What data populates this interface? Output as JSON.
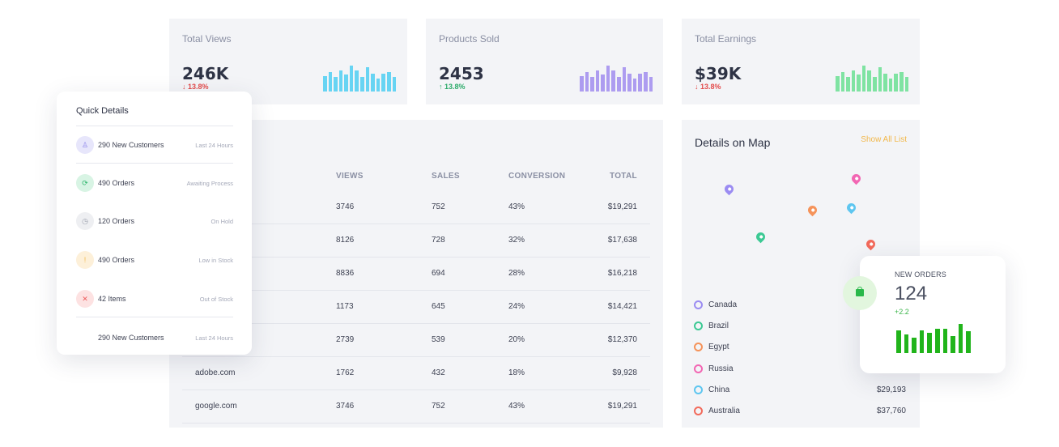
{
  "stats": [
    {
      "title": "Total Views",
      "value": "246K",
      "delta": "13.8%",
      "direction": "down",
      "color": "#67d4f3",
      "bars": [
        0.6,
        0.75,
        0.55,
        0.8,
        0.65,
        1.0,
        0.8,
        0.55,
        0.95,
        0.7,
        0.5,
        0.7,
        0.75,
        0.55
      ]
    },
    {
      "title": "Products Sold",
      "value": "2453",
      "delta": "13.8%",
      "direction": "up",
      "color": "#ad9cf0",
      "bars": [
        0.6,
        0.75,
        0.55,
        0.8,
        0.65,
        1.0,
        0.8,
        0.55,
        0.95,
        0.7,
        0.5,
        0.7,
        0.75,
        0.55
      ]
    },
    {
      "title": "Total Earnings",
      "value": "$39K",
      "delta": "13.8%",
      "direction": "down",
      "color": "#7fe3a2",
      "bars": [
        0.6,
        0.75,
        0.55,
        0.8,
        0.65,
        1.0,
        0.8,
        0.55,
        0.95,
        0.7,
        0.5,
        0.7,
        0.75,
        0.55
      ]
    }
  ],
  "table": {
    "headers": [
      "VIEWS",
      "SALES",
      "CONVERSION",
      "TOTAL"
    ],
    "rows": [
      {
        "source": "",
        "views": "3746",
        "sales": "752",
        "conversion": "43%",
        "total": "$19,291"
      },
      {
        "source": "",
        "views": "8126",
        "sales": "728",
        "conversion": "32%",
        "total": "$17,638"
      },
      {
        "source": "",
        "views": "8836",
        "sales": "694",
        "conversion": "28%",
        "total": "$16,218"
      },
      {
        "source": "",
        "views": "1173",
        "sales": "645",
        "conversion": "24%",
        "total": "$14,421"
      },
      {
        "source": "",
        "views": "2739",
        "sales": "539",
        "conversion": "20%",
        "total": "$12,370"
      },
      {
        "source": "adobe.com",
        "views": "1762",
        "sales": "432",
        "conversion": "18%",
        "total": "$9,928"
      },
      {
        "source": "google.com",
        "views": "3746",
        "sales": "752",
        "conversion": "43%",
        "total": "$19,291"
      }
    ]
  },
  "map": {
    "title": "Details on Map",
    "show_all": "Show All List",
    "countries": [
      {
        "name": "Canada",
        "value": "",
        "color": "#9b8cf2"
      },
      {
        "name": "Brazil",
        "value": "",
        "color": "#3cc994"
      },
      {
        "name": "Egypt",
        "value": "",
        "color": "#f5935a"
      },
      {
        "name": "Russia",
        "value": "",
        "color": "#f266b3"
      },
      {
        "name": "China",
        "value": "$29,193",
        "color": "#5ec6f0"
      },
      {
        "name": "Australia",
        "value": "$37,760",
        "color": "#f26a5b"
      }
    ]
  },
  "quick_details": {
    "title": "Quick Details",
    "items": [
      {
        "label": "290 New Customers",
        "meta": "Last 24 Hours",
        "icon": "user-plus-icon",
        "glyph": "♙",
        "bg": "#e7e6fb",
        "fg": "#8b82ea"
      },
      {
        "label": "490 Orders",
        "meta": "Awaiting Process",
        "icon": "refresh-icon",
        "glyph": "⟳",
        "bg": "#d8f4e4",
        "fg": "#2cb56b"
      },
      {
        "label": "120 Orders",
        "meta": "On Hold",
        "icon": "pause-icon",
        "glyph": "◷",
        "bg": "#eeeff2",
        "fg": "#9a9eab"
      },
      {
        "label": "490 Orders",
        "meta": "Low in Stock",
        "icon": "alert-icon",
        "glyph": "!",
        "bg": "#fdf0d9",
        "fg": "#f2b84b"
      },
      {
        "label": "42 Items",
        "meta": "Out of Stock",
        "icon": "cross-icon",
        "glyph": "✕",
        "bg": "#fde2e2",
        "fg": "#ef5c5c"
      },
      {
        "label": "290 New Customers",
        "meta": "Last 24 Hours",
        "icon": "",
        "glyph": "",
        "bg": "",
        "fg": ""
      }
    ]
  },
  "new_orders": {
    "label": "NEW ORDERS",
    "value": "124",
    "delta": "+2.2",
    "bars": [
      0.75,
      0.6,
      0.5,
      0.75,
      0.65,
      0.8,
      0.8,
      0.55,
      0.95,
      0.7
    ]
  }
}
